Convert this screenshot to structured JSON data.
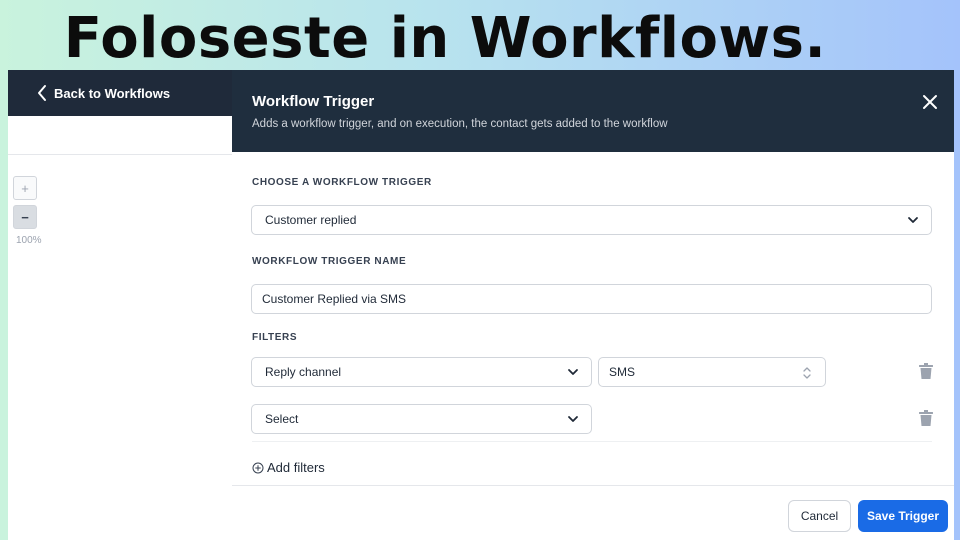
{
  "headline": "Foloseste in Workflows.",
  "left_panel": {
    "back_label": "Back to Workflows",
    "zoom_in_label": "+",
    "zoom_out_label": "−",
    "zoom_level": "100%"
  },
  "drawer": {
    "title": "Workflow Trigger",
    "subtitle": "Adds a workflow trigger, and on execution, the contact gets added to the workflow",
    "choose_label": "CHOOSE A WORKFLOW TRIGGER",
    "trigger_value": "Customer replied",
    "name_label": "WORKFLOW TRIGGER NAME",
    "name_value": "Customer Replied via SMS",
    "filters_label": "FILTERS",
    "filters": [
      {
        "field": "Reply channel",
        "value": "SMS"
      },
      {
        "field": "Select"
      }
    ],
    "add_filters_label": "Add filters",
    "cancel_label": "Cancel",
    "save_label": "Save Trigger"
  },
  "colors": {
    "header_bg": "#1f2e3e",
    "primary": "#1a6be6"
  },
  "icons": [
    "chevron-left-icon",
    "close-icon",
    "chevron-down-icon",
    "sort-icon",
    "trash-icon",
    "plus-circle-icon"
  ]
}
